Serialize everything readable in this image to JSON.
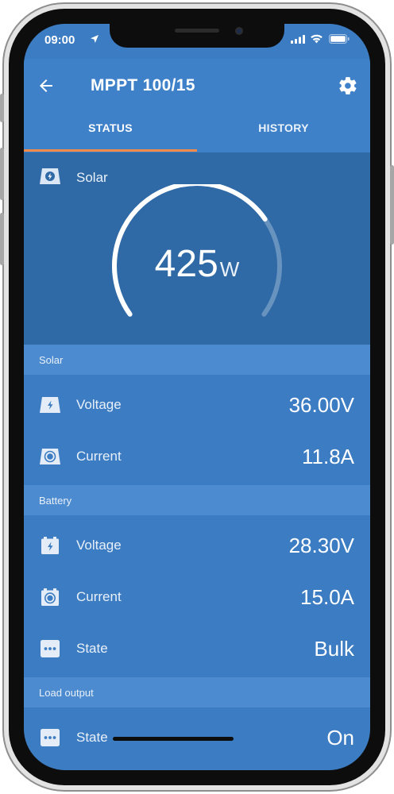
{
  "status_bar": {
    "time": "09:00"
  },
  "header": {
    "title": "MPPT 100/15"
  },
  "tabs": [
    {
      "label": "STATUS",
      "active": true
    },
    {
      "label": "HISTORY",
      "active": false
    }
  ],
  "hero": {
    "label": "Solar",
    "power_value": "425",
    "power_unit": "W",
    "gauge_fill_fraction": 0.72
  },
  "sections": [
    {
      "title": "Solar",
      "rows": [
        {
          "icon": "solar-voltage-icon",
          "label": "Voltage",
          "value": "36.00V"
        },
        {
          "icon": "solar-current-icon",
          "label": "Current",
          "value": "11.8A"
        }
      ]
    },
    {
      "title": "Battery",
      "rows": [
        {
          "icon": "battery-voltage-icon",
          "label": "Voltage",
          "value": "28.30V"
        },
        {
          "icon": "battery-current-icon",
          "label": "Current",
          "value": "15.0A"
        },
        {
          "icon": "more-dots-icon",
          "label": "State",
          "value": "Bulk"
        }
      ]
    },
    {
      "title": "Load output",
      "rows": [
        {
          "icon": "more-dots-icon",
          "label": "State",
          "value": "On"
        }
      ]
    }
  ],
  "colors": {
    "header_blue": "#3f81c8",
    "hero_blue": "#2f6aa7",
    "row_blue": "#3c7cc3",
    "section_blue": "#4d8bd0",
    "tab_accent": "#f28a4a"
  }
}
